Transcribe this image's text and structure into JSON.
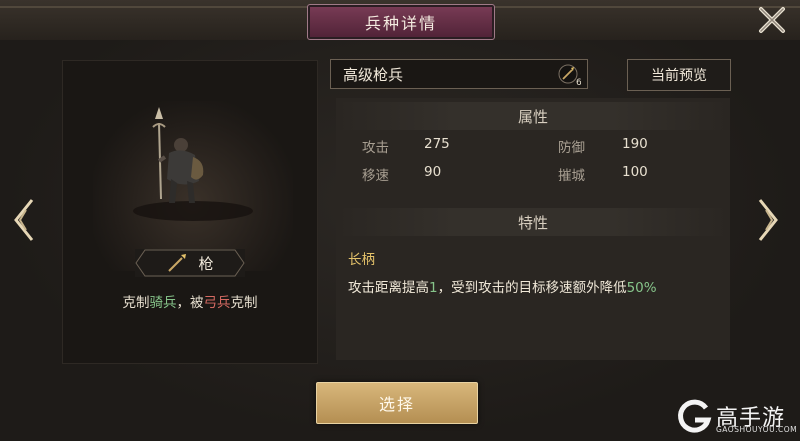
{
  "header": {
    "title": "兵种详情"
  },
  "unit": {
    "type_label": "枪",
    "counter": {
      "prefix": "克制",
      "strong_against": "骑兵",
      "middle": "，被",
      "weak_to": "弓兵",
      "suffix": "克制"
    }
  },
  "details": {
    "unit_name": "高级枪兵",
    "level_badge": "6",
    "preview_label": "当前预览",
    "attributes_title": "属性",
    "attributes": [
      {
        "label": "攻击",
        "value": "275"
      },
      {
        "label": "防御",
        "value": "190"
      },
      {
        "label": "移速",
        "value": "90"
      },
      {
        "label": "摧城",
        "value": "100"
      }
    ],
    "traits_title": "特性",
    "trait": {
      "name": "长柄",
      "desc_1": "攻击距离提高",
      "desc_val_1": "1",
      "desc_2": "，受到攻击的目标移速额外降低",
      "desc_val_2": "50%"
    }
  },
  "footer": {
    "select_label": "选择"
  },
  "watermark": {
    "main": "高手游",
    "sub": "GAOSHOUYOU.COM"
  },
  "colors": {
    "highlight_green": "#86c48a",
    "highlight_red": "#d66a62",
    "trait_gold": "#e4c26a",
    "accent_button": "#c9a765"
  }
}
